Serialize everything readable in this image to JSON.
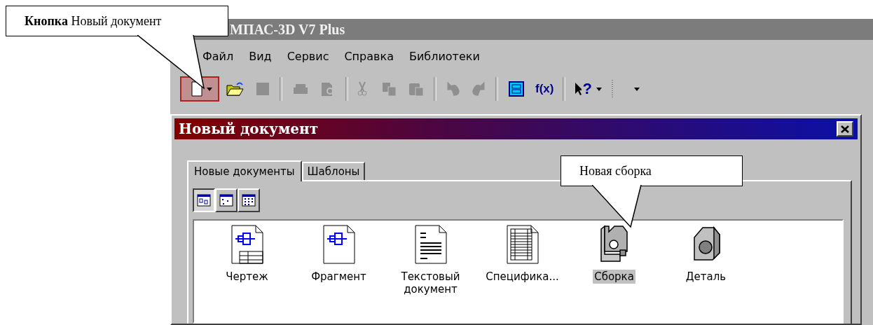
{
  "callouts": [
    {
      "text": "**Кнопка** Новый документ"
    },
    {
      "text": "Новая сборка"
    }
  ],
  "app": {
    "title": "МПАС-3D V7 Plus",
    "menu": [
      "Файл",
      "Вид",
      "Сервис",
      "Справка",
      "Библиотеки"
    ],
    "toolbar": [
      {
        "kind": "new",
        "highlighted": true,
        "disabled": false
      },
      {
        "kind": "open",
        "highlighted": false,
        "disabled": false
      },
      {
        "kind": "save",
        "highlighted": false,
        "disabled": true
      },
      {
        "kind": "separator"
      },
      {
        "kind": "print",
        "highlighted": false,
        "disabled": true
      },
      {
        "kind": "preview",
        "highlighted": false,
        "disabled": true
      },
      {
        "kind": "separator"
      },
      {
        "kind": "cut",
        "highlighted": false,
        "disabled": true
      },
      {
        "kind": "copy",
        "highlighted": false,
        "disabled": true
      },
      {
        "kind": "paste",
        "highlighted": false,
        "disabled": true
      },
      {
        "kind": "separator"
      },
      {
        "kind": "undo",
        "highlighted": false,
        "disabled": true
      },
      {
        "kind": "redo",
        "highlighted": false,
        "disabled": true
      },
      {
        "kind": "separator"
      },
      {
        "kind": "manager",
        "highlighted": false,
        "disabled": false
      },
      {
        "kind": "formula",
        "label": "f(x)",
        "highlighted": false,
        "disabled": false
      },
      {
        "kind": "separator"
      },
      {
        "kind": "help",
        "label": "?",
        "highlighted": false,
        "disabled": false
      },
      {
        "kind": "grip"
      },
      {
        "kind": "more",
        "highlighted": false
      }
    ]
  },
  "dialog": {
    "title": "Новый документ",
    "tabs": [
      {
        "label": "Новые документы",
        "selected": true
      },
      {
        "label": "Шаблоны",
        "selected": false
      }
    ],
    "view_buttons": [
      {
        "kind": "large",
        "selected": true
      },
      {
        "kind": "small",
        "selected": false
      },
      {
        "kind": "list",
        "selected": false
      }
    ],
    "items": [
      {
        "kind": "drawing",
        "label": "Чертеж",
        "selected": false
      },
      {
        "kind": "fragment",
        "label": "Фрагмент",
        "selected": false
      },
      {
        "kind": "text",
        "label": "Текстовый документ",
        "selected": false
      },
      {
        "kind": "spec",
        "label": "Специфика...",
        "selected": false
      },
      {
        "kind": "assembly",
        "label": "Сборка",
        "selected": true
      },
      {
        "kind": "part",
        "label": "Деталь",
        "selected": false
      }
    ]
  }
}
